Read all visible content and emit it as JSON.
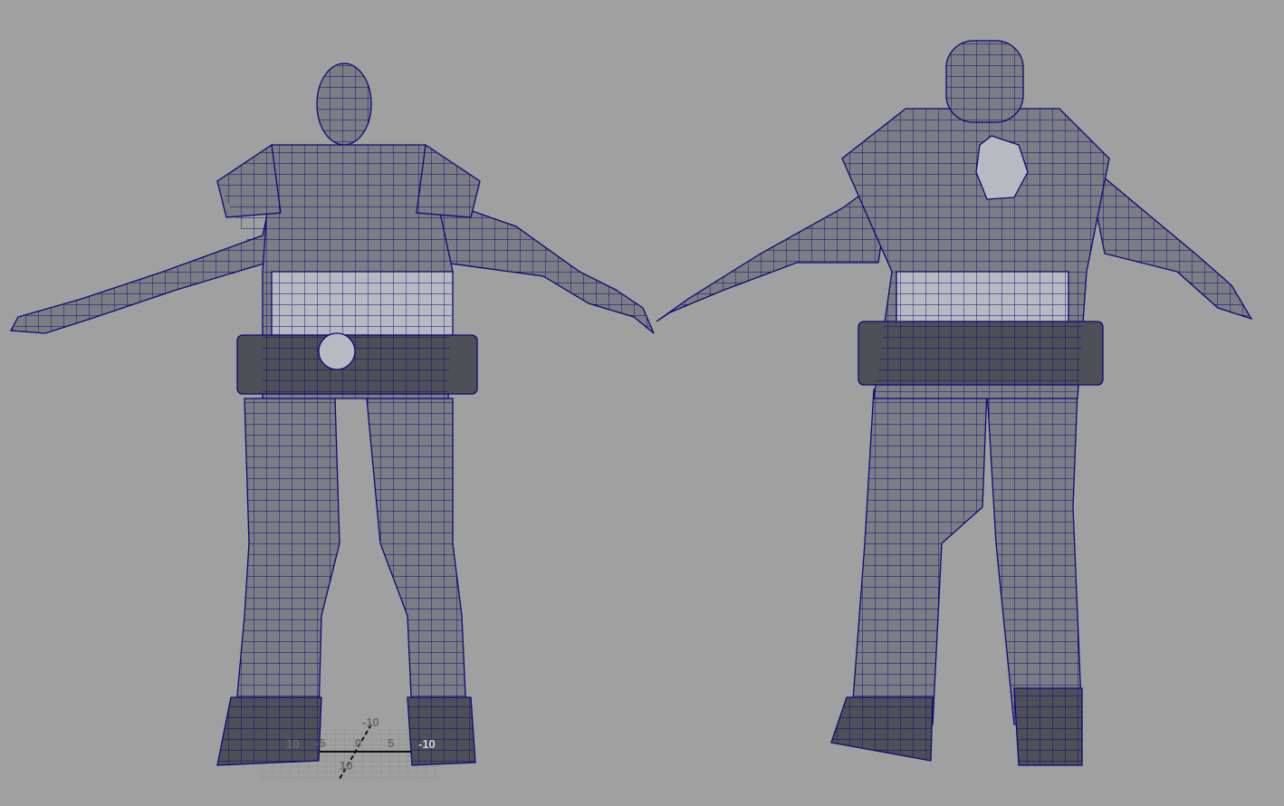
{
  "viewport": {
    "background_color": "#a0a0a0",
    "wire_color": "#0a0a78",
    "views": [
      "front",
      "back"
    ]
  },
  "grid": {
    "labels": {
      "neg_z": "-10",
      "pos_x": "10",
      "neg_x_half": "-5",
      "origin": "0",
      "pos_x_half": "5",
      "pos_z": "10",
      "neg_x": "-10"
    }
  }
}
